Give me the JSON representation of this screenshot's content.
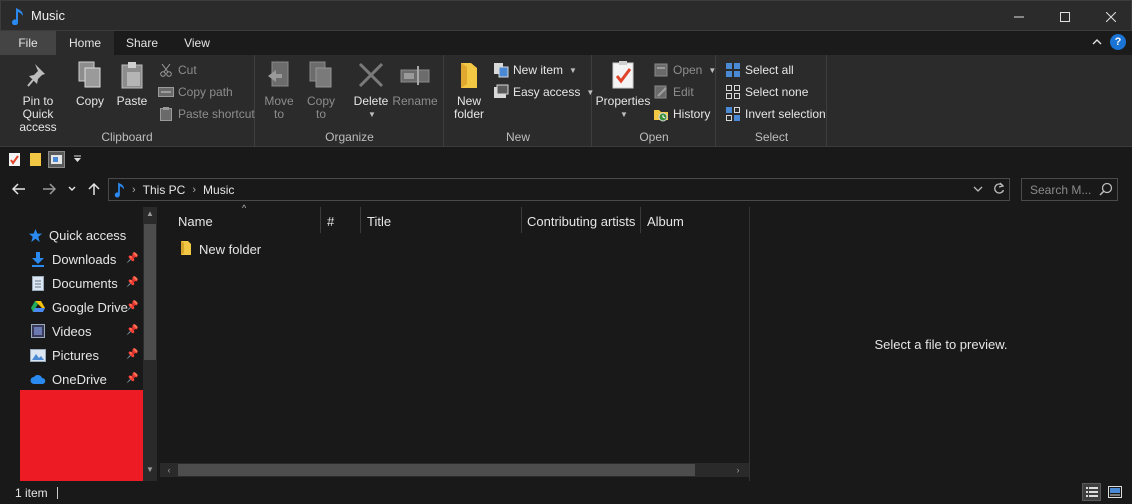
{
  "window": {
    "title": "Music"
  },
  "tabs": {
    "file": "File",
    "home": "Home",
    "share": "Share",
    "view": "View"
  },
  "ribbon": {
    "clipboard": {
      "label": "Clipboard",
      "pin_line1": "Pin to Quick",
      "pin_line2": "access",
      "copy": "Copy",
      "paste": "Paste",
      "cut": "Cut",
      "copy_path": "Copy path",
      "paste_shortcut": "Paste shortcut"
    },
    "organize": {
      "label": "Organize",
      "move_line1": "Move",
      "move_line2": "to",
      "copy_line1": "Copy",
      "copy_line2": "to",
      "delete": "Delete",
      "rename": "Rename"
    },
    "new": {
      "label": "New",
      "folder_line1": "New",
      "folder_line2": "folder",
      "new_item": "New item",
      "easy_access": "Easy access"
    },
    "open": {
      "label": "Open",
      "properties": "Properties",
      "open": "Open",
      "edit": "Edit",
      "history": "History"
    },
    "select": {
      "label": "Select",
      "select_all": "Select all",
      "select_none": "Select none",
      "invert": "Invert selection"
    }
  },
  "address": {
    "crumbs": [
      "This PC",
      "Music"
    ]
  },
  "search": {
    "placeholder": "Search M..."
  },
  "navpane": {
    "quick_access": "Quick access",
    "items": [
      "Downloads",
      "Documents",
      "Google Drive",
      "Videos",
      "Pictures",
      "OneDrive"
    ]
  },
  "columns": [
    "Name",
    "#",
    "Title",
    "Contributing artists",
    "Album"
  ],
  "files": [
    {
      "name": "New folder"
    }
  ],
  "preview": {
    "message": "Select a file to preview."
  },
  "status": {
    "count": "1 item"
  },
  "colors": {
    "accent": "#1a74d6",
    "folder": "#f2c744",
    "redaction": "#ed1c24"
  }
}
